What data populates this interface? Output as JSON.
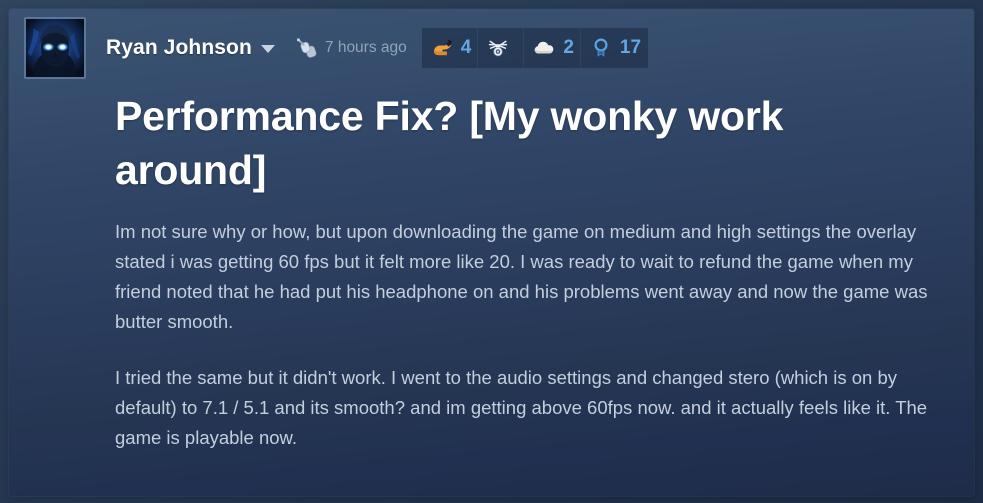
{
  "post": {
    "author": {
      "name": "Ryan Johnson",
      "avatar_alt": "hooded figure with glowing blue eyes",
      "dropdown_icon": "chevron-down-icon"
    },
    "meta": {
      "award_received_icon": "dogtag-award-icon",
      "timestamp": "7 hours ago"
    },
    "awards": [
      {
        "icon": "golden-hand-award-icon",
        "icon_label": "golden-hand",
        "count": "4"
      },
      {
        "icon": "deer-god-award-icon",
        "icon_label": "deer-god",
        "count": ""
      },
      {
        "icon": "clever-cloud-award-icon",
        "icon_label": "clever-cloud",
        "count": "2"
      },
      {
        "icon": "award-ribbon-icon",
        "icon_label": "award-ribbon",
        "count": "17"
      }
    ],
    "title": "Performance Fix? [My wonky work around]",
    "paragraphs": [
      "Im not sure why or how, but upon downloading the game on medium and high settings the overlay stated i was getting 60 fps but it felt more like 20. I was ready to wait to refund the game when my friend noted that he had put his headphone on and his problems went away and now the game was butter smooth.",
      "I tried the same but it didn't work. I went to the audio settings and changed stero (which is on by default) to 7.1 / 5.1 and its smooth? and im getting above 60fps now. and it actually feels like it. The game is playable now."
    ]
  },
  "colors": {
    "page_background": "#2b3e57",
    "card_top": "#3b5272",
    "card_bottom": "#1e2c49",
    "title_text": "#ffffff",
    "body_text": "#c3cfdd",
    "meta_text": "#8fa3bb",
    "award_count": "#63a7e6",
    "golden_hand": "#eda140"
  }
}
